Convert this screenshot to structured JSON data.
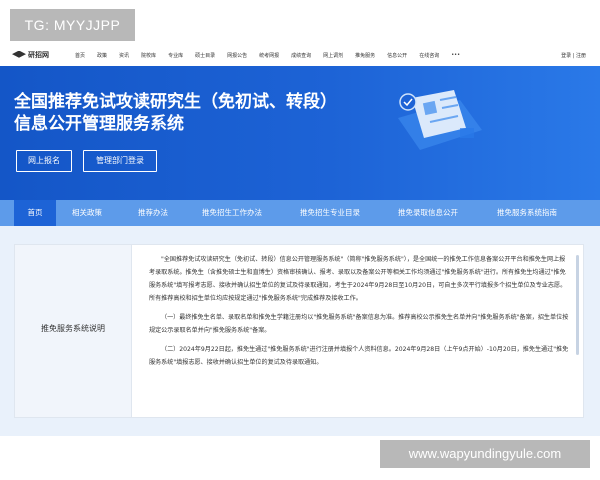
{
  "watermark_top": "TG: MYYJJPP",
  "watermark_bottom": "www.wapyundingyule.com",
  "logo": "研招网",
  "nav": {
    "links": [
      "首页",
      "政策",
      "资讯",
      "院校库",
      "专业库",
      "硕士目录",
      "网报公告",
      "统考网报",
      "成绩查询",
      "网上调剂",
      "推免服务",
      "信息公开",
      "在线咨询",
      "•••"
    ],
    "login": "登录",
    "register": "注册",
    "sep": "|"
  },
  "hero": {
    "title_line1": "全国推荐免试攻读研究生（免初试、转段）",
    "title_line2": "信息公开管理服务系统",
    "btn_apply": "网上报名",
    "btn_admin": "管理部门登录"
  },
  "menu": [
    "首页",
    "相关政策",
    "推荐办法",
    "推免招生工作办法",
    "推免招生专业目录",
    "推免录取信息公开",
    "推免服务系统指南"
  ],
  "panel": {
    "heading": "推免服务系统说明",
    "p1": "\"全国推荐免试攻读研究生（免初试、转段）信息公开管理服务系统\"（简称\"推免服务系统\"），是全国统一的推免工作信息备案公开平台和推免生网上报考录取系统。推免生（含推免硕士生和直博生）资格审核确认、报考、录取以及备案公开等相关工作均须通过\"推免服务系统\"进行。所有推免生均通过\"推免服务系统\"填写报考志愿、接收并确认招生单位的复试及待录取通知，考生于2024年9月28日至10月20日，可自主多次平行填报多个招生单位及专业志愿。所有推荐高校和招生单位均应按规定通过\"推免服务系统\"完成推荐及接收工作。",
    "p2": "（一）最终推免生名单、录取名单和推免生学籍注册均以\"推免服务系统\"备案信息为准。推荐高校公示推免生名单并向\"推免服务系统\"备案，招生单位按规定公示录取名单并向\"推免服务系统\"备案。",
    "p3": "（二）2024年9月22日起，推免生通过\"推免服务系统\"进行注册并填报个人资料信息。2024年9月28日（上午9点开始）-10月20日，推免生通过\"推免服务系统\"填报志愿、接收并确认招生单位的复试及待录取通知。"
  }
}
